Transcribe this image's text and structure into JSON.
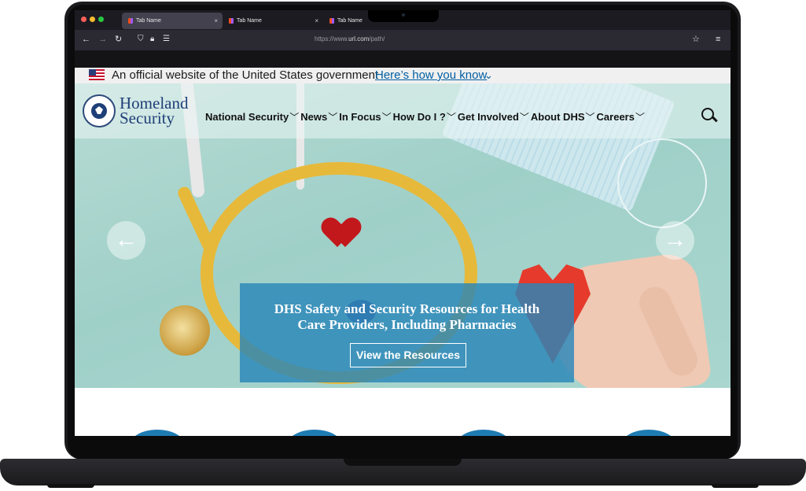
{
  "browser": {
    "tabs": [
      {
        "label": "Tab Name",
        "close": "×"
      },
      {
        "label": "Tab Name",
        "close": "×"
      },
      {
        "label": "Tab Name"
      }
    ],
    "url_prefix": "https://www.",
    "url_domain": "url.com",
    "url_path": "/path/"
  },
  "gov_banner": {
    "text": "An official website of the United States government",
    "link": "Here’s how you know"
  },
  "header": {
    "brand_line1": "Homeland",
    "brand_line2": "Security",
    "nav": [
      "National Security",
      "News",
      "In Focus",
      "How Do I ?",
      "Get Involved",
      "About DHS",
      "Careers"
    ]
  },
  "hero": {
    "title_line1": "DHS Safety and Security Resources for Health",
    "title_line2": "Care Providers, Including Pharmacies",
    "button": "View the Resources",
    "prev": "←",
    "next": "→"
  },
  "colors": {
    "dhs_blue": "#1e3f78",
    "caption_blue": "#2986b8",
    "link_blue": "#005ea2"
  }
}
